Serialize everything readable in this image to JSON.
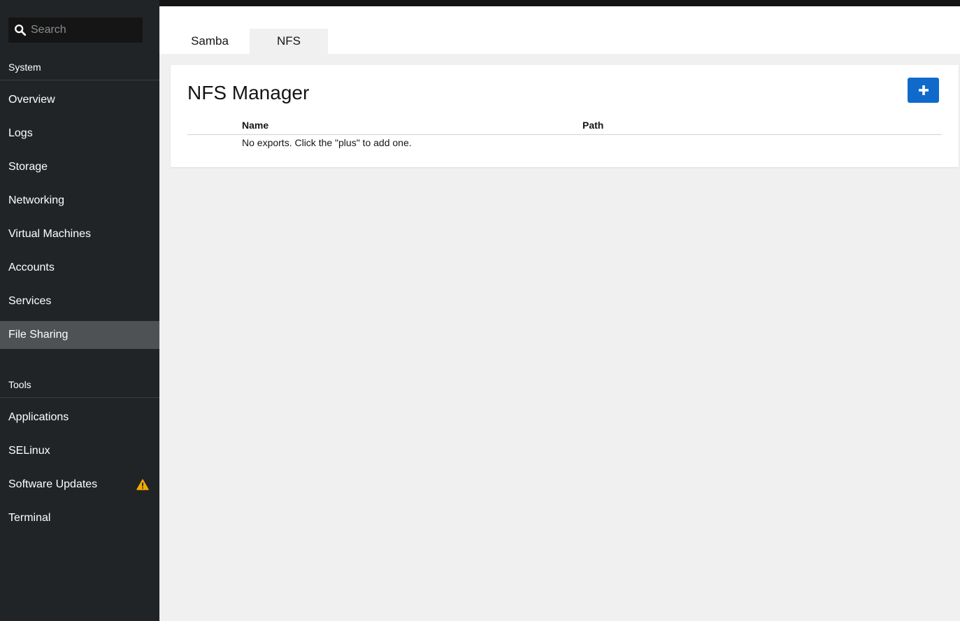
{
  "sidebar": {
    "search_placeholder": "Search",
    "sections": [
      {
        "label": "System"
      },
      {
        "label": "Tools"
      }
    ],
    "system_items": [
      {
        "label": "Overview"
      },
      {
        "label": "Logs"
      },
      {
        "label": "Storage"
      },
      {
        "label": "Networking"
      },
      {
        "label": "Virtual Machines"
      },
      {
        "label": "Accounts"
      },
      {
        "label": "Services"
      },
      {
        "label": "File Sharing",
        "active": true
      }
    ],
    "tools_items": [
      {
        "label": "Applications"
      },
      {
        "label": "SELinux"
      },
      {
        "label": "Software Updates",
        "badge": "warning-icon"
      },
      {
        "label": "Terminal"
      }
    ]
  },
  "tabs": [
    {
      "label": "Samba"
    },
    {
      "label": "NFS",
      "active": true
    }
  ],
  "card": {
    "title": "NFS Manager",
    "add_button_icon": "plus-icon",
    "columns": [
      "Name",
      "Path"
    ],
    "empty_message": "No exports. Click the \"plus\" to add one."
  },
  "colors": {
    "accent": "#0f6acb",
    "warning": "#f0ab00",
    "sidebar_bg": "#212427",
    "active_item_bg": "#4f5255"
  }
}
